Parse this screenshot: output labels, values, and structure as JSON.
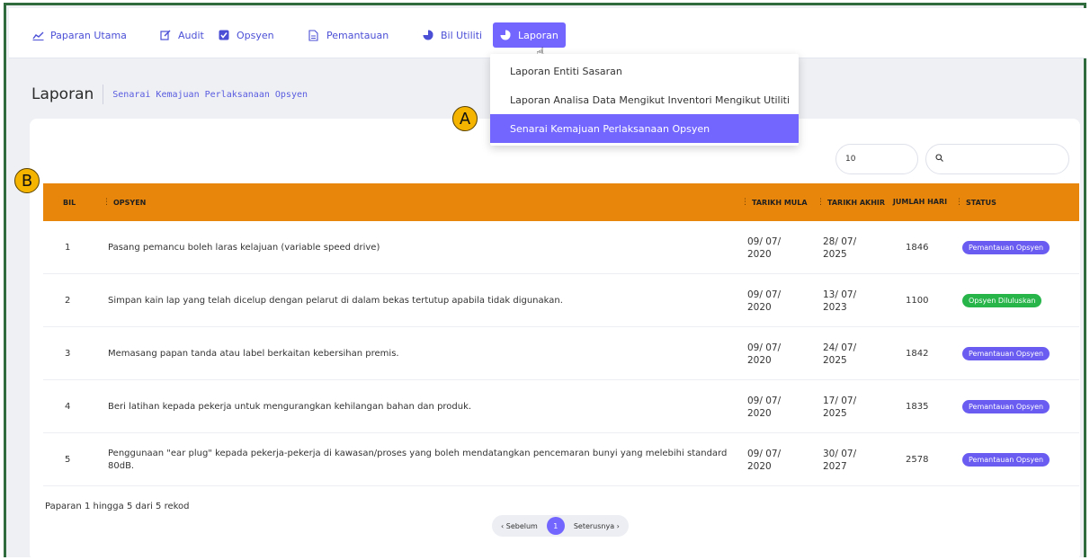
{
  "nav": {
    "items": [
      {
        "label": "Paparan Utama",
        "icon": "trend-chart-icon"
      },
      {
        "label": "Audit",
        "icon": "edit-icon"
      },
      {
        "label": "Opsyen",
        "icon": "checkbox-icon"
      },
      {
        "label": "Pemantauan",
        "icon": "document-icon"
      },
      {
        "label": "Bil Utiliti",
        "icon": "pie-chart-icon"
      },
      {
        "label": "Laporan",
        "icon": "pie-chart-icon"
      }
    ],
    "active_index": 5
  },
  "dropdown": {
    "items": [
      "Laporan Entiti Sasaran",
      "Laporan Analisa Data Mengikut Inventori Mengikut Utiliti",
      "Senarai Kemajuan Perlaksanaan Opsyen"
    ],
    "active_index": 2
  },
  "header": {
    "title": "Laporan",
    "subtitle": "Senarai Kemajuan Perlaksanaan Opsyen"
  },
  "controls": {
    "page_size": "10",
    "search_placeholder": ""
  },
  "table": {
    "columns": [
      "BIL",
      "OPSYEN",
      "TARIKH MULA",
      "TARIKH AKHIR",
      "JUMLAH HARI",
      "STATUS"
    ],
    "rows": [
      {
        "bil": "1",
        "opsyen": "Pasang pemancu boleh laras kelajuan (variable speed drive)",
        "mula_a": "09/ 07/",
        "mula_b": "2020",
        "akhir_a": "28/ 07/",
        "akhir_b": "2025",
        "hari": "1846",
        "status": "Pemantauan Opsyen",
        "status_color": "#6a5cf0"
      },
      {
        "bil": "2",
        "opsyen": "Simpan kain lap yang telah dicelup dengan pelarut di dalam bekas tertutup apabila tidak digunakan.",
        "mula_a": "09/ 07/",
        "mula_b": "2020",
        "akhir_a": "13/ 07/",
        "akhir_b": "2023",
        "hari": "1100",
        "status": "Opsyen Diluluskan",
        "status_color": "#27b54a"
      },
      {
        "bil": "3",
        "opsyen": "Memasang papan tanda atau label berkaitan kebersihan premis.",
        "mula_a": "09/ 07/",
        "mula_b": "2020",
        "akhir_a": "24/ 07/",
        "akhir_b": "2025",
        "hari": "1842",
        "status": "Pemantauan Opsyen",
        "status_color": "#6a5cf0"
      },
      {
        "bil": "4",
        "opsyen": "Beri latihan kepada pekerja untuk mengurangkan kehilangan bahan dan produk.",
        "mula_a": "09/ 07/",
        "mula_b": "2020",
        "akhir_a": "17/ 07/",
        "akhir_b": "2025",
        "hari": "1835",
        "status": "Pemantauan Opsyen",
        "status_color": "#6a5cf0"
      },
      {
        "bil": "5",
        "opsyen": "Penggunaan \"ear plug\" kepada pekerja-pekerja di kawasan/proses yang boleh mendatangkan pencemaran bunyi yang melebihi standard 80dB.",
        "mula_a": "09/ 07/",
        "mula_b": "2020",
        "akhir_a": "30/ 07/",
        "akhir_b": "2027",
        "hari": "2578",
        "status": "Pemantauan Opsyen",
        "status_color": "#6a5cf0"
      }
    ]
  },
  "footer": {
    "summary": "Paparan 1 hingga 5 dari 5 rekod",
    "prev": "‹ Sebelum",
    "page": "1",
    "next": "Seterusnya ›"
  },
  "markers": {
    "a": "A",
    "b": "B"
  },
  "colors": {
    "accent": "#7366ff",
    "header": "#e8860c",
    "frame": "#2f6b3c"
  }
}
